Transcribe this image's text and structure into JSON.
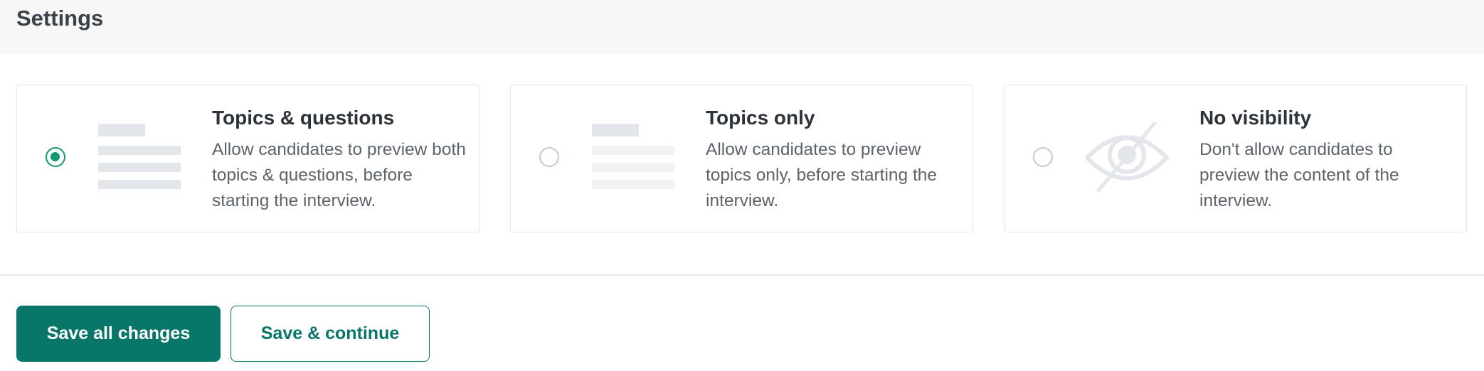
{
  "header": {
    "title": "Settings"
  },
  "options": [
    {
      "title": "Topics & questions",
      "description": "Allow candidates to preview both topics & questions, before starting the interview.",
      "selected": true,
      "icon": "topics-questions-illustration-icon"
    },
    {
      "title": "Topics only",
      "description": "Allow candidates to preview topics only, before starting the interview.",
      "selected": false,
      "icon": "topics-only-illustration-icon"
    },
    {
      "title": "No visibility",
      "description": "Don't allow candidates to preview the content of the interview.",
      "selected": false,
      "icon": "eye-slash-icon"
    }
  ],
  "actions": {
    "save_all_label": "Save all changes",
    "save_continue_label": "Save & continue"
  },
  "colors": {
    "accent": "#09766a",
    "radio_selected": "#0f9a72",
    "header_bg": "#f7f7f8",
    "illustration": "#e3e6ea"
  }
}
